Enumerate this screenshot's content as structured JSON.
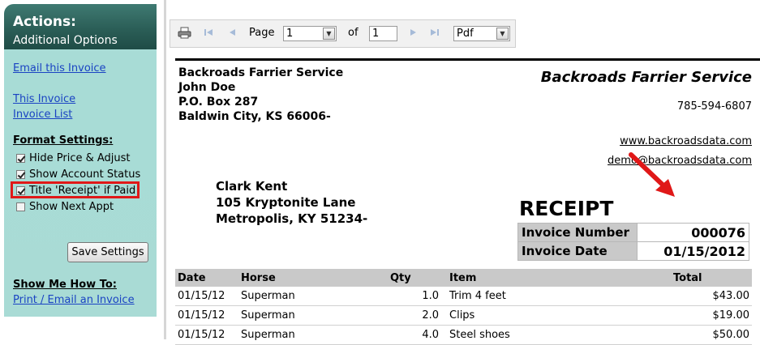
{
  "sidebar": {
    "title": "Actions:",
    "subtitle": "Additional Options",
    "links": {
      "email_invoice": "Email this Invoice",
      "this_invoice": "This Invoice",
      "invoice_list": "Invoice List"
    },
    "format_settings": {
      "heading": "Format Settings:",
      "options": [
        {
          "label": "Hide Price & Adjust",
          "checked": true
        },
        {
          "label": "Show Account Status",
          "checked": true
        },
        {
          "label": "Title 'Receipt' if Paid",
          "checked": true
        },
        {
          "label": "Show Next Appt",
          "checked": false
        }
      ],
      "save_label": "Save Settings"
    },
    "how_to": {
      "heading": "Show Me How To:",
      "link": "Print / Email an Invoice"
    }
  },
  "toolbar": {
    "page_label": "Page",
    "page_value": "1",
    "of_label": "of",
    "total_pages": "1",
    "format_value": "Pdf"
  },
  "invoice": {
    "from": {
      "company": "Backroads Farrier Service",
      "name": "John Doe",
      "address1": "P.O. Box 287",
      "address2": "Baldwin City, KS  66006-"
    },
    "header_company": "Backroads Farrier Service",
    "phone": "785-594-6807",
    "website": "www.backroadsdata.com",
    "email": "demo@backroadsdata.com",
    "to": {
      "name": "Clark Kent",
      "address1": "105 Kryptonite Lane",
      "address2": "Metropolis, KY  51234-"
    },
    "title": "RECEIPT",
    "number_label": "Invoice Number",
    "number_value": "000076",
    "date_label": "Invoice Date",
    "date_value": "01/15/2012",
    "columns": {
      "date": "Date",
      "horse": "Horse",
      "qty": "Qty",
      "item": "Item",
      "total": "Total"
    },
    "rows": [
      {
        "date": "01/15/12",
        "horse": "Superman",
        "qty": "1.0",
        "item": "Trim 4 feet",
        "total": "$43.00"
      },
      {
        "date": "01/15/12",
        "horse": "Superman",
        "qty": "2.0",
        "item": "Clips",
        "total": "$19.00"
      },
      {
        "date": "01/15/12",
        "horse": "Superman",
        "qty": "4.0",
        "item": "Steel shoes",
        "total": "$50.00"
      }
    ]
  },
  "colors": {
    "sidebar_header": "#2b5e57",
    "sidebar_body": "#a9dbd5",
    "link": "#1a43c3",
    "highlight": "#e01818",
    "table_header": "#c9c9c9"
  }
}
